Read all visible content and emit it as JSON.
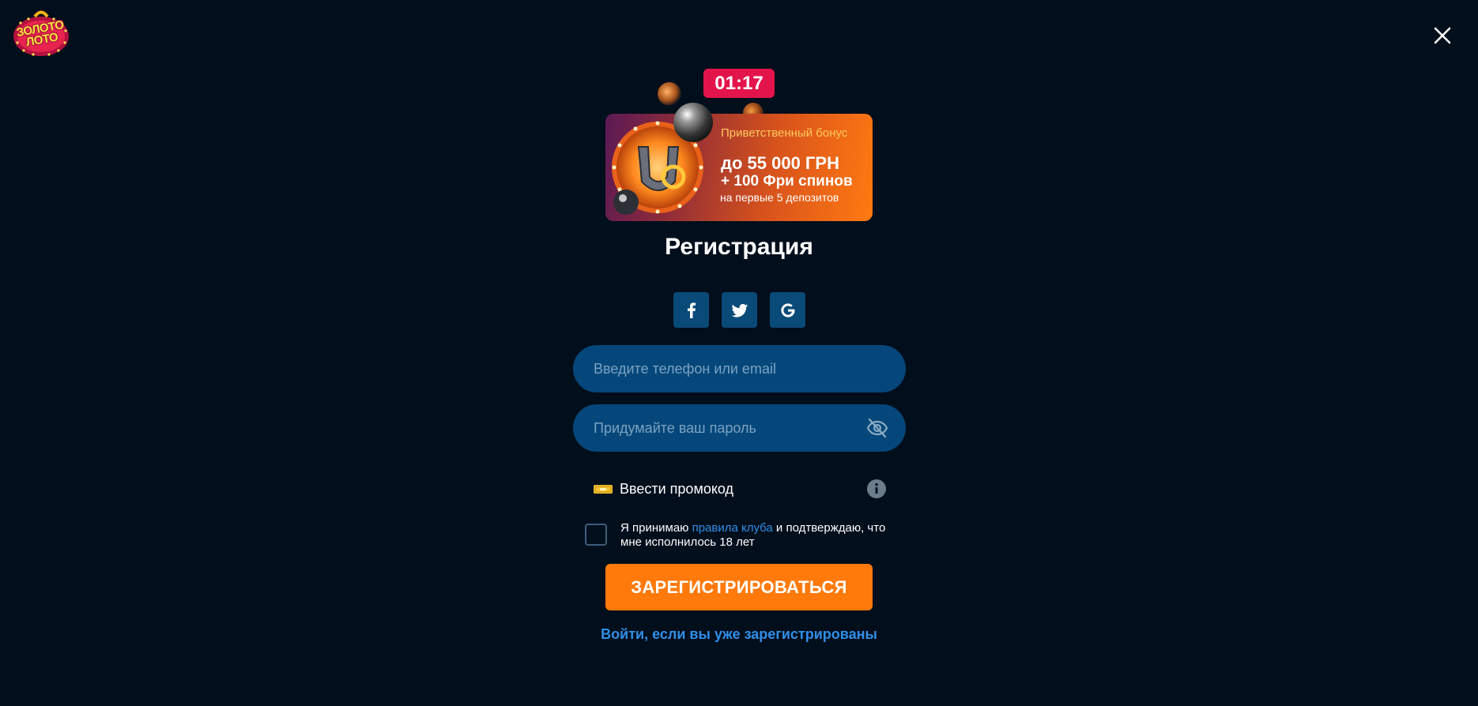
{
  "brand": {
    "logo_text": "ЗОЛОТО ЛОТО"
  },
  "timer": {
    "value": "01:17"
  },
  "bonus": {
    "subtitle": "Приветственный бонус",
    "amount": "до 55 000 ГРН",
    "spins": "+ 100 Фри спинов",
    "note": "на первые 5 депозитов"
  },
  "form": {
    "title": "Регистрация",
    "social": [
      {
        "name": "facebook-icon"
      },
      {
        "name": "twitter-icon"
      },
      {
        "name": "google-icon"
      }
    ],
    "phone_placeholder": "Введите телефон или email",
    "phone_value": "",
    "password_placeholder": "Придумайте ваш пароль",
    "password_value": "",
    "promo_label": "Ввести промокод",
    "terms_prefix": "Я принимаю ",
    "terms_link": "правила клуба",
    "terms_suffix": " и подтверждаю, что мне исполнилось 18 лет",
    "terms_checked": false,
    "submit_label": "ЗАРЕГИСТРИРОВАТЬСЯ",
    "login_link": "Войти, если вы уже зарегистрированы"
  },
  "colors": {
    "background": "#010e1c",
    "timer": "#e3144b",
    "input": "#05477a",
    "social": "#0a4a78",
    "accent_orange": "#ff7a0a",
    "link_blue": "#2f8fe8",
    "bonus_gold": "#ffc95c"
  },
  "icons": {
    "close": "close-icon",
    "eye": "eye-off-icon",
    "promo": "ticket-icon",
    "info": "info-icon"
  }
}
